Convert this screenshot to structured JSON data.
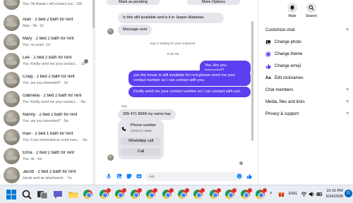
{
  "chat_list": {
    "items": [
      {
        "name": "",
        "preview": "You: Ok thanks i will contact you · 23h"
      },
      {
        "name": "Alan · 2 bed 2 bath for rent",
        "preview": "Alan · Nn ·1d"
      },
      {
        "name": "Mary · 2 bed 2 bath for rent",
        "preview": "You: no scam ·1d"
      },
      {
        "name": "Lee · 2 bed 2 bath for rent",
        "preview": "You: Kindly send me your contact... · 1d"
      },
      {
        "name": "Craig · 2 bed 2 bath for rent",
        "preview": "You: are you interested? · 1d"
      },
      {
        "name": "Gabriella · 2 bed 2 bath for rent",
        "preview": "You: Kindly send me your contact... · 4w"
      },
      {
        "name": "Manny · 2 bed 2 bath for rent",
        "preview": "You: are you interested? · 5w"
      },
      {
        "name": "Ravi · 2 bed 1 bath for rent",
        "preview": "You: if you interested so send num... · 5w"
      },
      {
        "name": "Elma · 2 bed 2 bath for rent",
        "preview": "You: ok · 6w"
      },
      {
        "name": "Jacob · 2 bed 2 bath for rent",
        "preview": "Jacob sent an attachment. · 7w"
      }
    ]
  },
  "conversation": {
    "top_buttons": {
      "mark_pending": "Mark as pending",
      "more_options": "More Options"
    },
    "messages": {
      "m1": "Is this still available and is it in Jasper Alabama",
      "m2": "Message sent",
      "waiting": "Kay is waiting for your response.",
      "time": "8:36 PM",
      "m3": "Yes. Are you interested?",
      "m4": "yes the house is still available for rent,please send me your contact number so I can contact with you.",
      "m5": "Kindly send me your contact number so I can contact with you.",
      "sender": "Kay",
      "m6": "205 471 8668 my name kay"
    },
    "contact_card": {
      "name": "Phone number",
      "number": "(205)471-8668",
      "whatsapp": "WhatsApp call",
      "call": "Call"
    },
    "composer": {
      "placeholder": "Aa"
    }
  },
  "details": {
    "mute": "Mute",
    "search": "Search",
    "customize_chat": "Customize chat",
    "change_photo": "Change photo",
    "change_theme": "Change theme",
    "change_emoji": "Change emoji",
    "edit_nicknames": "Edit nicknames",
    "chat_members": "Chat members",
    "media_files_links": "Media, files and links",
    "privacy_support": "Privacy & support"
  },
  "taskbar": {
    "lang": "ENG",
    "time": "10:16 PM",
    "date": "6/24/2026",
    "notif_count": "21"
  },
  "colors": {
    "accent": "#5b3ff0",
    "messenger_blue": "#0a7cff"
  }
}
